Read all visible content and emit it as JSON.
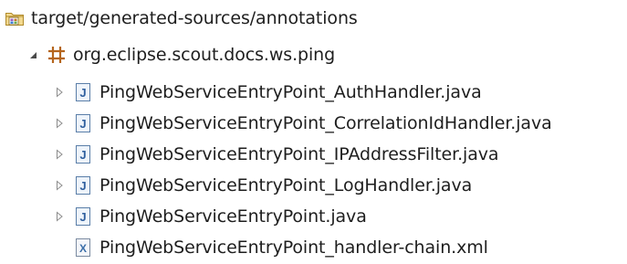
{
  "tree": {
    "root": {
      "label": "target/generated-sources/annotations",
      "icon": "source-folder-icon",
      "expanded": true
    },
    "package": {
      "label": "org.eclipse.scout.docs.ws.ping",
      "icon": "package-icon",
      "expanded": true
    },
    "files": [
      {
        "label": "PingWebServiceEntryPoint_AuthHandler.java",
        "icon": "java-file-icon",
        "expandable": true
      },
      {
        "label": "PingWebServiceEntryPoint_CorrelationIdHandler.java",
        "icon": "java-file-icon",
        "expandable": true
      },
      {
        "label": "PingWebServiceEntryPoint_IPAddressFilter.java",
        "icon": "java-file-icon",
        "expandable": true
      },
      {
        "label": "PingWebServiceEntryPoint_LogHandler.java",
        "icon": "java-file-icon",
        "expandable": true
      },
      {
        "label": "PingWebServiceEntryPoint.java",
        "icon": "java-file-icon",
        "expandable": true
      },
      {
        "label": "PingWebServiceEntryPoint_handler-chain.xml",
        "icon": "xml-file-icon",
        "expandable": false
      }
    ]
  }
}
